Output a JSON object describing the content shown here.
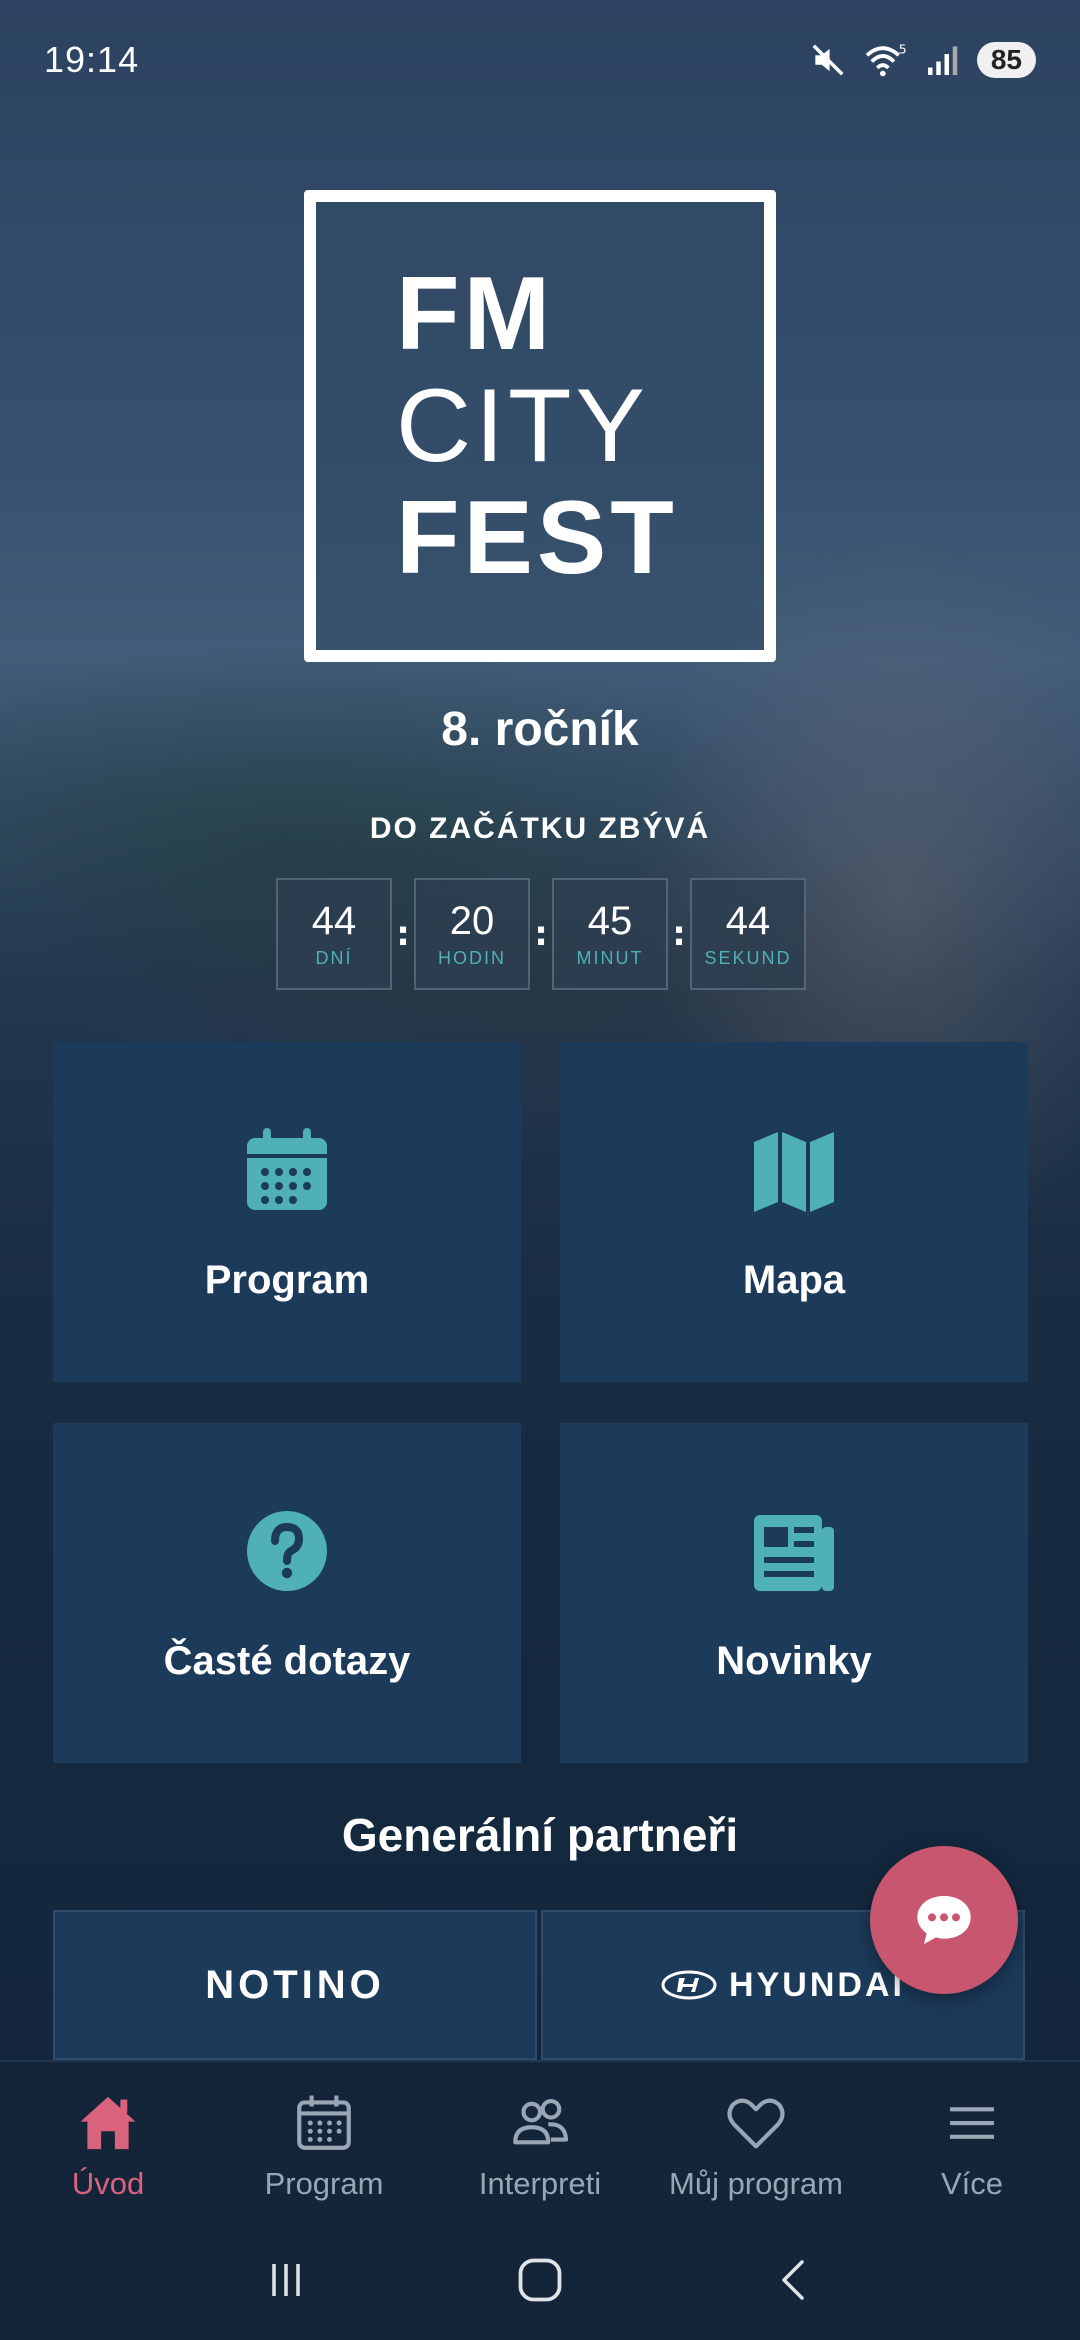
{
  "status_bar": {
    "time": "19:14",
    "battery": "85",
    "icons": [
      "mute-icon",
      "wifi-icon",
      "signal-icon",
      "battery-icon"
    ]
  },
  "logo": {
    "lines": [
      "FM",
      "CITY",
      "FEST"
    ]
  },
  "edition": "8. ročník",
  "countdown": {
    "title": "DO ZAČÁTKU ZBÝVÁ",
    "units": [
      {
        "value": "44",
        "label": "DNÍ"
      },
      {
        "value": "20",
        "label": "HODIN"
      },
      {
        "value": "45",
        "label": "MINUT"
      },
      {
        "value": "44",
        "label": "SEKUND"
      }
    ],
    "separator": ":"
  },
  "tiles": [
    {
      "label": "Program",
      "icon": "calendar-icon"
    },
    {
      "label": "Mapa",
      "icon": "map-icon"
    },
    {
      "label": "Časté dotazy",
      "icon": "question-icon"
    },
    {
      "label": "Novinky",
      "icon": "newspaper-icon"
    }
  ],
  "partners": {
    "title": "Generální partneři",
    "items": [
      "NOTINO",
      "HYUNDAI"
    ]
  },
  "bottom_nav": [
    {
      "label": "Úvod",
      "icon": "home-icon",
      "active": true
    },
    {
      "label": "Program",
      "icon": "calendar-icon",
      "active": false
    },
    {
      "label": "Interpreti",
      "icon": "people-icon",
      "active": false
    },
    {
      "label": "Můj program",
      "icon": "heart-icon",
      "active": false
    },
    {
      "label": "Více",
      "icon": "menu-icon",
      "active": false
    }
  ],
  "colors": {
    "accent": "#d9627d",
    "teal": "#4fb0b8",
    "tile": "#1c3a5a",
    "nav_bg": "#14253a"
  }
}
